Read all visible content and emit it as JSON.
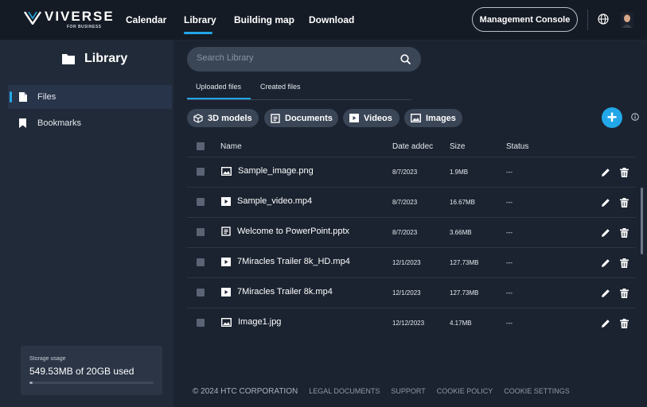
{
  "brand": {
    "name": "VIVERSE",
    "sub": "FOR BUSINESS"
  },
  "nav": {
    "items": [
      {
        "label": "Calendar"
      },
      {
        "label": "Library"
      },
      {
        "label": "Building map"
      },
      {
        "label": "Download"
      }
    ],
    "management_label": "Management Console"
  },
  "sidebar": {
    "title": "Library",
    "items": [
      {
        "label": "Files",
        "icon": "file-icon"
      },
      {
        "label": "Bookmarks",
        "icon": "bookmark-icon"
      }
    ],
    "storage": {
      "caption": "Storage usage",
      "value": "549.53MB of 20GB used",
      "fraction": 0.027
    }
  },
  "search": {
    "placeholder": "Search Library"
  },
  "subtabs": [
    {
      "label": "Uploaded files"
    },
    {
      "label": "Created files"
    }
  ],
  "filters": [
    {
      "label": "3D models",
      "icon": "cube-icon"
    },
    {
      "label": "Documents",
      "icon": "document-icon"
    },
    {
      "label": "Videos",
      "icon": "video-icon"
    },
    {
      "label": "Images",
      "icon": "image-icon"
    }
  ],
  "table": {
    "headers": {
      "name": "Name",
      "date": "Date addec",
      "size": "Size",
      "status": "Status"
    },
    "rows": [
      {
        "name": "Sample_image.png",
        "type": "image",
        "date": "8/7/2023",
        "size": "1.9MB",
        "status": "---"
      },
      {
        "name": "Sample_video.mp4",
        "type": "video",
        "date": "8/7/2023",
        "size": "16.67MB",
        "status": "---"
      },
      {
        "name": "Welcome to PowerPoint.pptx",
        "type": "document",
        "date": "8/7/2023",
        "size": "3.66MB",
        "status": "---"
      },
      {
        "name": "7Miracles Trailer 8k_HD.mp4",
        "type": "video",
        "date": "12/1/2023",
        "size": "127.73MB",
        "status": "---"
      },
      {
        "name": "7Miracles Trailer 8k.mp4",
        "type": "video",
        "date": "12/1/2023",
        "size": "127.73MB",
        "status": "---"
      },
      {
        "name": "Image1.jpg",
        "type": "image",
        "date": "12/12/2023",
        "size": "4.17MB",
        "status": "---"
      }
    ]
  },
  "footer": {
    "copyright": "© 2024 HTC CORPORATION",
    "links": [
      "LEGAL DOCUMENTS",
      "SUPPORT",
      "COOKIE POLICY",
      "COOKIE SETTINGS"
    ]
  },
  "colors": {
    "accent": "#22a7e8",
    "background": "#1b2330",
    "sidebar": "#212a38",
    "chip": "#3a4556"
  }
}
